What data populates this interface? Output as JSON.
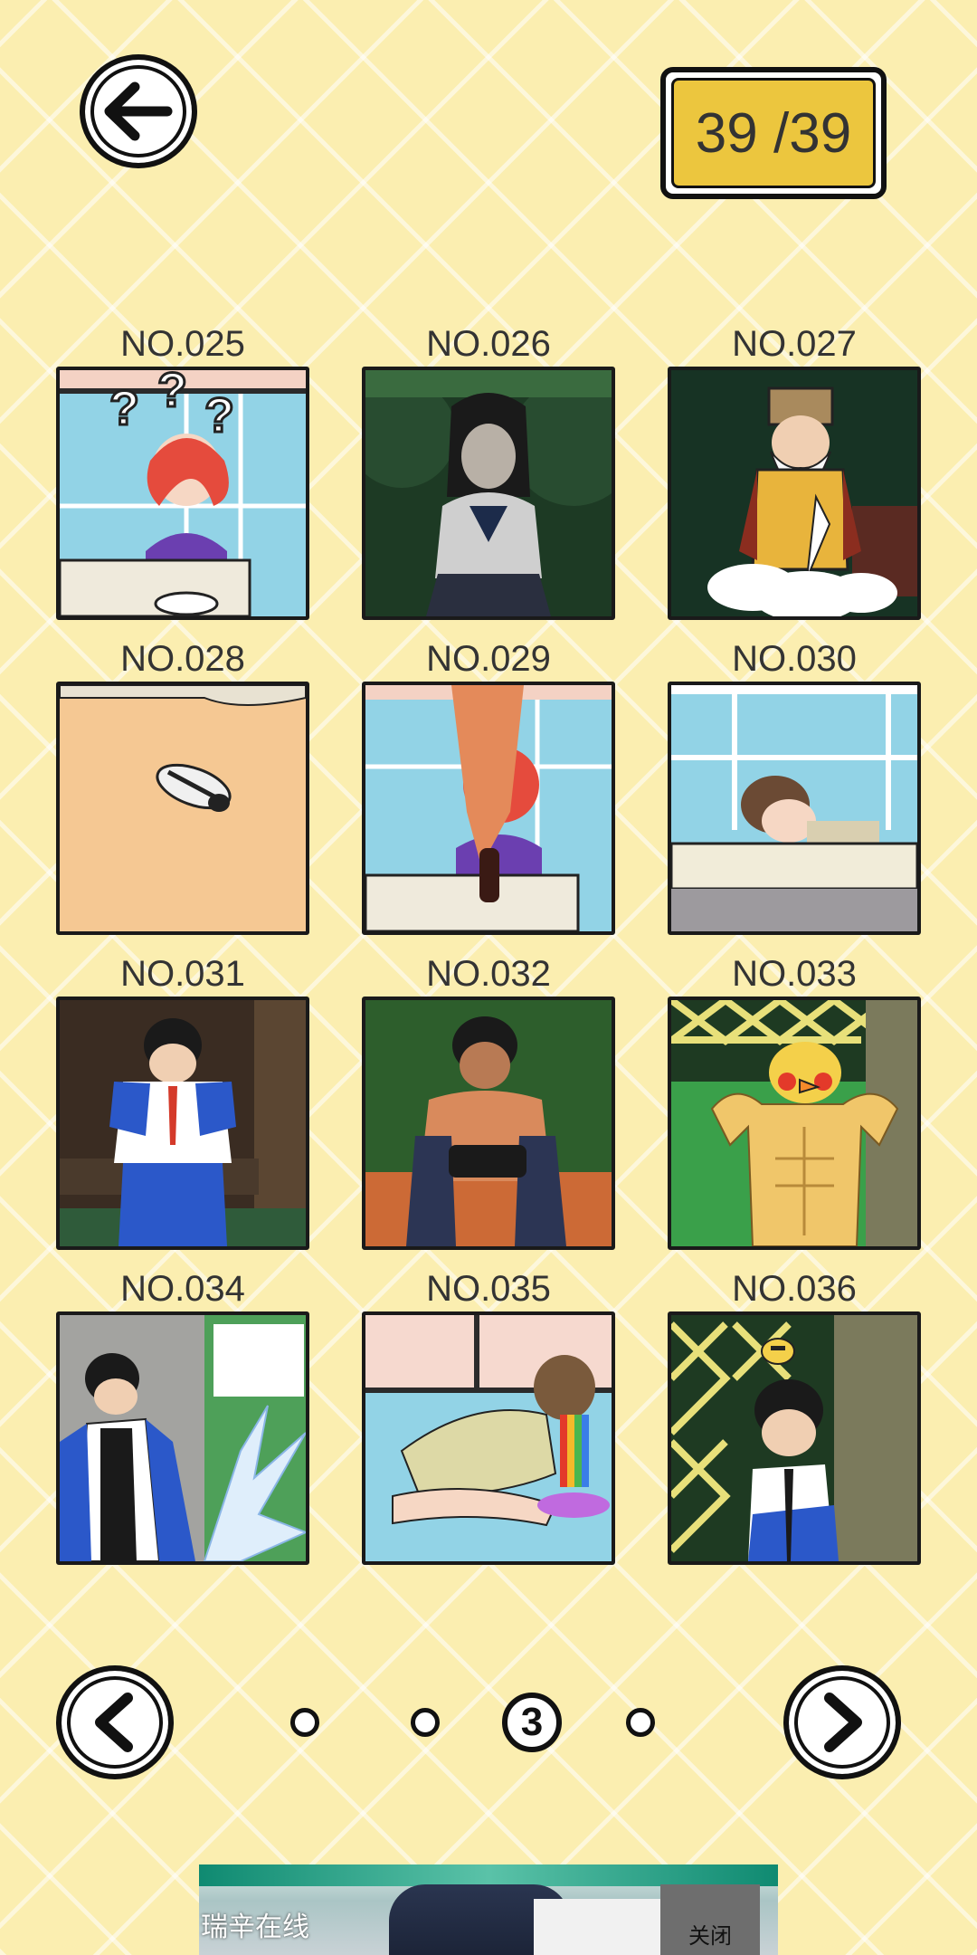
{
  "counter": {
    "text": "39 /39"
  },
  "cards": [
    {
      "label": "NO.025",
      "scene": "girl-confused-at-sink"
    },
    {
      "label": "NO.026",
      "scene": "dark-girl-in-forest"
    },
    {
      "label": "NO.027",
      "scene": "old-man-on-cloud"
    },
    {
      "label": "NO.028",
      "scene": "shoe-on-floor"
    },
    {
      "label": "NO.029",
      "scene": "girl-soda-fountain"
    },
    {
      "label": "NO.030",
      "scene": "boy-sleeping-at-desk"
    },
    {
      "label": "NO.031",
      "scene": "boy-on-bench"
    },
    {
      "label": "NO.032",
      "scene": "boy-with-gamepad"
    },
    {
      "label": "NO.033",
      "scene": "muscular-duck"
    },
    {
      "label": "NO.034",
      "scene": "boy-water-splash"
    },
    {
      "label": "NO.035",
      "scene": "girl-rainbow"
    },
    {
      "label": "NO.036",
      "scene": "boy-crying-bee"
    }
  ],
  "pagination": {
    "current_page": "3"
  },
  "ad": {
    "brand": "瑞辛在线",
    "close_label": "关闭"
  },
  "colors": {
    "background": "#fbeeb0",
    "counter_fill": "#ecc63e",
    "outline": "#111111"
  },
  "icons": {
    "back": "arrow-left-icon",
    "prev": "chevron-left-icon",
    "next": "chevron-right-icon"
  }
}
